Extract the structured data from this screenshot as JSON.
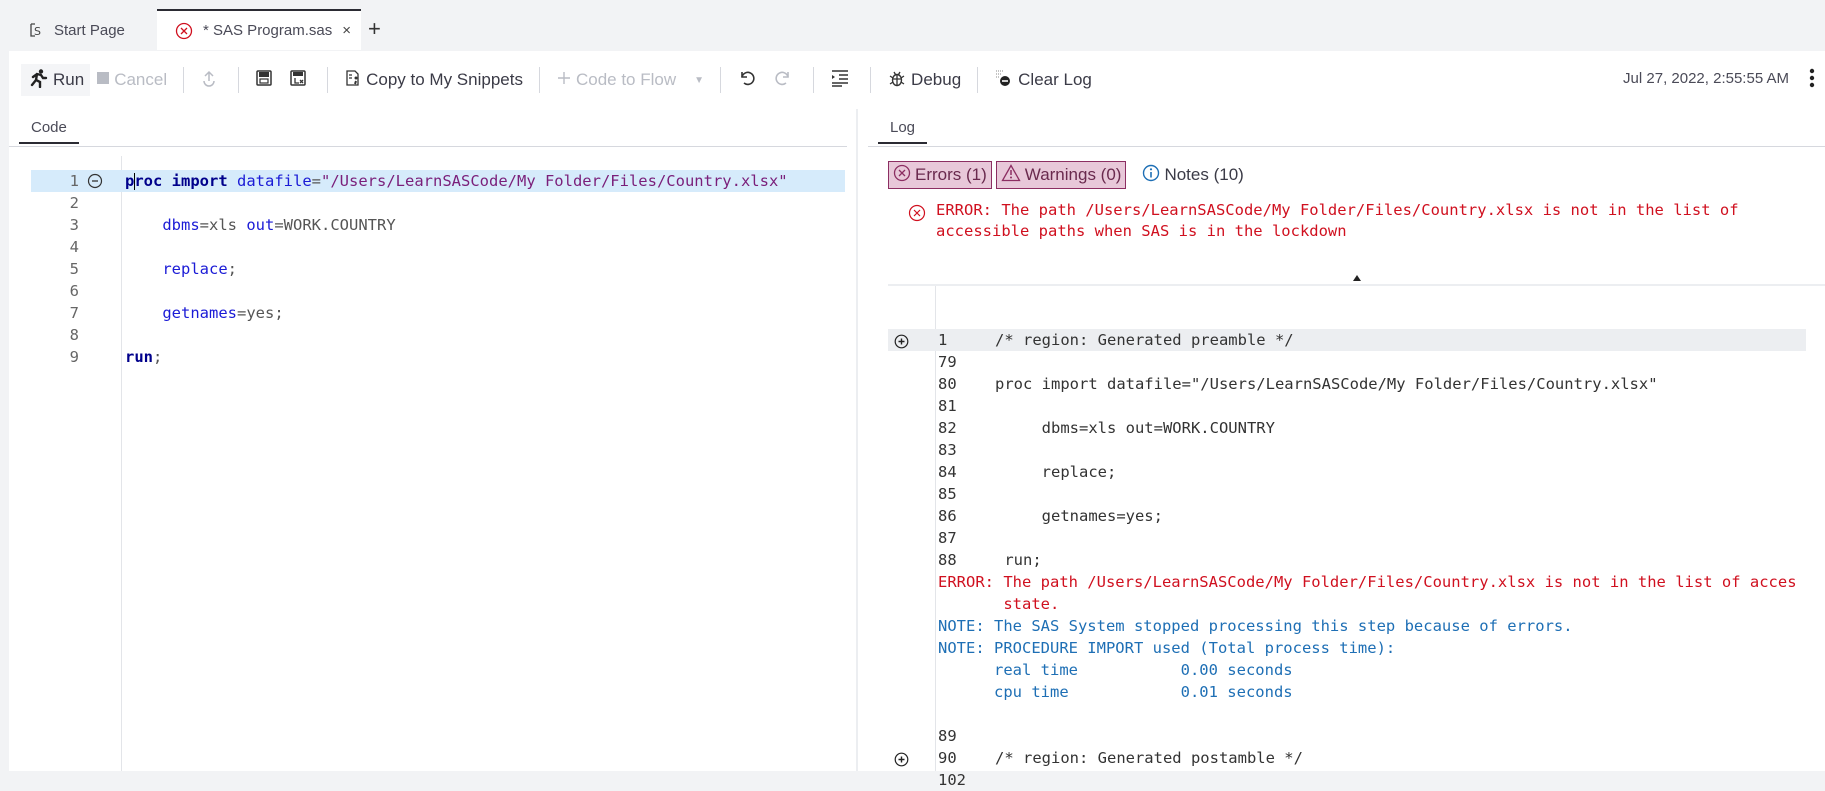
{
  "tabs": [
    {
      "label": "Start Page",
      "icon": "start-page-icon"
    },
    {
      "label": "* SAS Program.sas",
      "icon": "error-circle-icon",
      "active": true
    }
  ],
  "toolbar": {
    "run": "Run",
    "cancel": "Cancel",
    "copy_snippets": "Copy to My Snippets",
    "code_to_flow": "Code to Flow",
    "debug": "Debug",
    "clear_log": "Clear Log",
    "timestamp": "Jul 27, 2022, 2:55:55 AM"
  },
  "code_panel": {
    "tab": "Code",
    "lines": [
      {
        "n": "1",
        "tokens": [
          [
            "kw",
            "proc"
          ],
          [
            "pl",
            " "
          ],
          [
            "kw",
            "import"
          ],
          [
            "pl",
            " "
          ],
          [
            "at",
            "datafile"
          ],
          [
            "op",
            "="
          ],
          [
            "st",
            "\"/Users/LearnSASCode/My Folder/Files/Country.xlsx\""
          ]
        ]
      },
      {
        "n": "2",
        "tokens": []
      },
      {
        "n": "3",
        "tokens": [
          [
            "pl",
            "    "
          ],
          [
            "at",
            "dbms"
          ],
          [
            "op",
            "="
          ],
          [
            "pl",
            "xls "
          ],
          [
            "at",
            "out"
          ],
          [
            "op",
            "="
          ],
          [
            "pl",
            "WORK.COUNTRY"
          ]
        ]
      },
      {
        "n": "4",
        "tokens": []
      },
      {
        "n": "5",
        "tokens": [
          [
            "pl",
            "    "
          ],
          [
            "at",
            "replace"
          ],
          [
            "op",
            ";"
          ]
        ]
      },
      {
        "n": "6",
        "tokens": []
      },
      {
        "n": "7",
        "tokens": [
          [
            "pl",
            "    "
          ],
          [
            "at",
            "getnames"
          ],
          [
            "op",
            "="
          ],
          [
            "pl",
            "yes;"
          ]
        ]
      },
      {
        "n": "8",
        "tokens": []
      },
      {
        "n": "9",
        "tokens": [
          [
            "kw",
            "run"
          ],
          [
            "op",
            ";"
          ]
        ]
      }
    ]
  },
  "log_panel": {
    "tab": "Log",
    "filters": {
      "errors": "Errors (1)",
      "warnings": "Warnings (0)",
      "notes": "Notes (10)"
    },
    "error_summary": "ERROR: The path /Users/LearnSASCode/My Folder/Files/Country.xlsx is not in the list of\naccessible paths when SAS is in the lockdown",
    "lines": [
      {
        "n": "1",
        "text": "/* region: Generated preamble */",
        "type": "src",
        "expand": true,
        "hl": true
      },
      {
        "n": "79",
        "text": "",
        "type": "src"
      },
      {
        "n": "80",
        "text": "proc import datafile=\"/Users/LearnSASCode/My Folder/Files/Country.xlsx\"",
        "type": "src"
      },
      {
        "n": "81",
        "text": "",
        "type": "src"
      },
      {
        "n": "82",
        "text": "     dbms=xls out=WORK.COUNTRY",
        "type": "src"
      },
      {
        "n": "83",
        "text": "",
        "type": "src"
      },
      {
        "n": "84",
        "text": "     replace;",
        "type": "src"
      },
      {
        "n": "85",
        "text": "",
        "type": "src"
      },
      {
        "n": "86",
        "text": "     getnames=yes;",
        "type": "src"
      },
      {
        "n": "87",
        "text": "",
        "type": "src"
      },
      {
        "n": "88",
        "text": " run;",
        "type": "src"
      },
      {
        "text": "ERROR: The path /Users/LearnSASCode/My Folder/Files/Country.xlsx is not in the list of acces",
        "type": "err"
      },
      {
        "text": "       state.",
        "type": "err"
      },
      {
        "text": "NOTE: The SAS System stopped processing this step because of errors.",
        "type": "note"
      },
      {
        "text": "NOTE: PROCEDURE IMPORT used (Total process time):",
        "type": "note"
      },
      {
        "text": "      real time           0.00 seconds",
        "type": "note"
      },
      {
        "text": "      cpu time            0.01 seconds",
        "type": "note"
      },
      {
        "text": "",
        "type": "blank"
      },
      {
        "n": "89",
        "text": "",
        "type": "src"
      },
      {
        "n": "90",
        "text": "/* region: Generated postamble */",
        "type": "src",
        "expand": true
      },
      {
        "n": "102",
        "text": "",
        "type": "src"
      }
    ]
  },
  "colors": {
    "error": "#d0101f",
    "note": "#1e6fb5",
    "filter_bg": "#e8c8d9",
    "filter_border": "#8c2e62",
    "line_highlight": "#d6ebfb"
  }
}
